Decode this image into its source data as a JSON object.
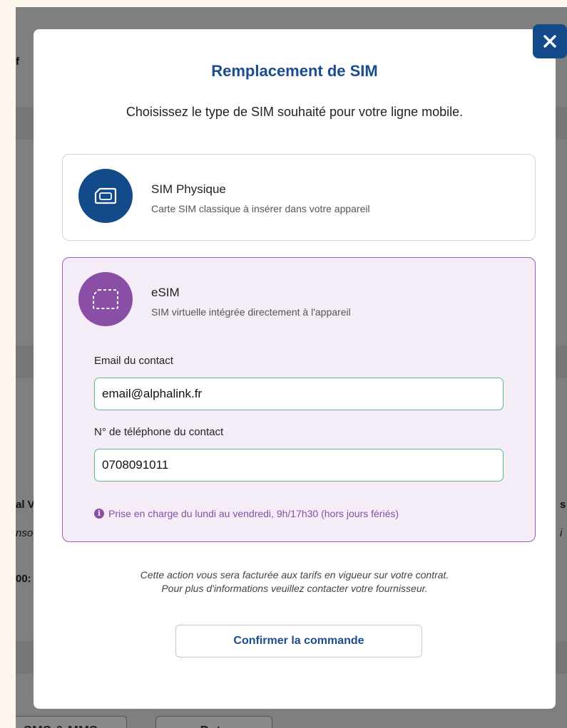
{
  "background": {
    "fragments": [
      "f",
      "al V",
      "nso",
      "00:",
      "s",
      "i"
    ],
    "tabs": [
      "SMS & MMS",
      "Data"
    ]
  },
  "modal": {
    "close_label": "close",
    "title": "Remplacement de SIM",
    "subtitle": "Choisissez le type de SIM souhaité pour votre ligne mobile.",
    "options": [
      {
        "title": "SIM Physique",
        "description": "Carte SIM classique à insérer dans votre appareil",
        "icon": "sim-card-icon",
        "color": "#124a8a"
      },
      {
        "title": "eSIM",
        "description": "SIM virtuelle intégrée directement à l'appareil",
        "icon": "esim-icon",
        "color": "#8a4ea6",
        "selected": true
      }
    ],
    "email_label": "Email du contact",
    "email_value": "email@alphalink.fr",
    "phone_label": "N° de téléphone du contact",
    "phone_value": "0708091011",
    "notice": "Prise en charge du lundi au vendredi, 9h/17h30 (hors jours fériés)",
    "billing_line1": "Cette action vous sera facturée aux tarifs en vigueur sur votre contrat.",
    "billing_line2": "Pour plus d'informations veuillez contacter votre fournisseur.",
    "confirm_label": "Confirmer la commande"
  },
  "colors": {
    "primary": "#1a4d8f",
    "accent": "#8a4ea6",
    "input_border": "#5cb88a"
  }
}
